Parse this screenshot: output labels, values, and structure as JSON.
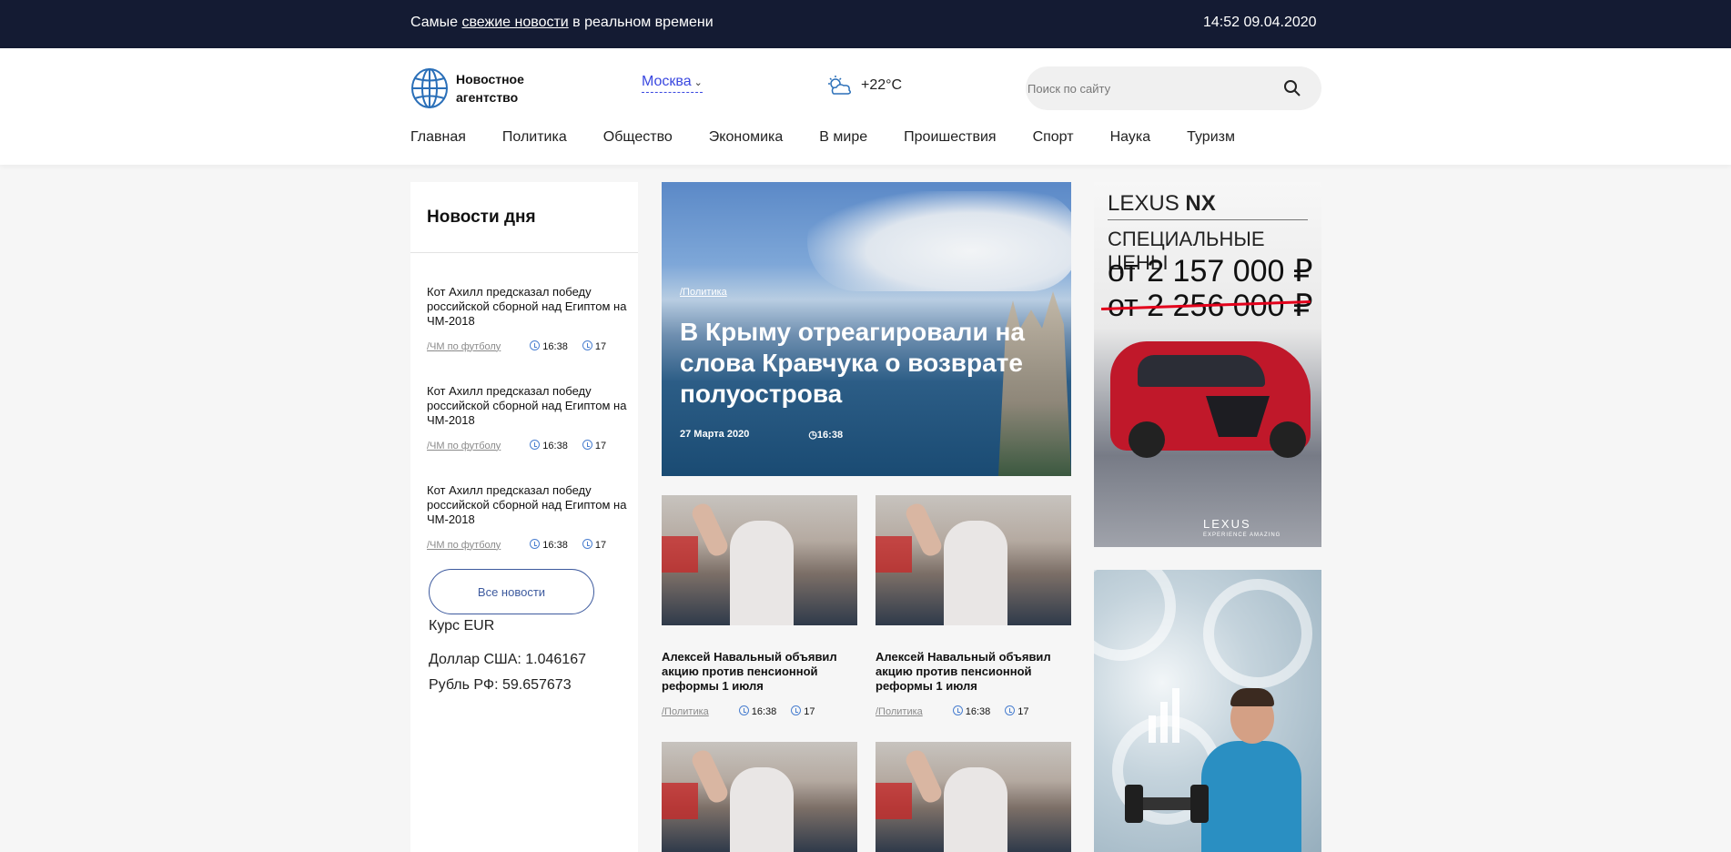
{
  "topbar": {
    "tagline_before": "Самые ",
    "tagline_link": "свежие новости",
    "tagline_after": " в реальном времени",
    "datetime": "14:52 09.04.2020"
  },
  "header": {
    "logo_line1": "Новостное",
    "logo_line2": "агентство",
    "city": "Москва",
    "temperature": "+22°C",
    "search_placeholder": "Поиск по сайту"
  },
  "nav": [
    "Главная",
    "Политика",
    "Общество",
    "Экономика",
    "В мире",
    "Проишествия",
    "Спорт",
    "Наука",
    "Туризм"
  ],
  "sidebar": {
    "title": "Новости дня",
    "items": [
      {
        "title": "Кот Ахилл предсказал победу российской сборной над Египтом на ЧМ-2018",
        "rubric": "/ЧМ по футболу",
        "time": "16:38",
        "comments": "17"
      },
      {
        "title": "Кот Ахилл предсказал победу российской сборной над Египтом на ЧМ-2018",
        "rubric": "/ЧМ по футболу",
        "time": "16:38",
        "comments": "17"
      },
      {
        "title": "Кот Ахилл предсказал победу российской сборной над Египтом на ЧМ-2018",
        "rubric": "/ЧМ по футболу",
        "time": "16:38",
        "comments": "17"
      }
    ],
    "all_news_label": "Все новости",
    "currency_title": "Курс EUR",
    "usd": "Доллар США: 1.046167",
    "rub": "Рубль РФ: 59.657673"
  },
  "hero": {
    "rubric": "/Политика",
    "title": "В Крыму отреагировали на слова Кравчука о возврате полуострова",
    "date": "27 Марта 2020",
    "time": "16:38"
  },
  "cards": [
    {
      "title": "Алексей Навальный объявил акцию против пенсионной реформы 1 июля",
      "rubric": "/Политика",
      "time": "16:38",
      "comments": "17"
    },
    {
      "title": "Алексей Навальный объявил акцию против пенсионной реформы 1 июля",
      "rubric": "/Политика",
      "time": "16:38",
      "comments": "17"
    }
  ],
  "ads": {
    "lexus_brand": "LEXUS",
    "lexus_model": "NX",
    "lexus_special": "СПЕЦИАЛЬНЫЕ ЦЕНЫ",
    "lexus_price_new": "от 2 157 000 ₽",
    "lexus_price_old": "от 2 256 000 ₽",
    "lexus_logo": "LEXUS",
    "lexus_slogan": "EXPERIENCE AMAZING"
  },
  "colors": {
    "topbar_bg": "#141b33",
    "accent_link": "#3a48e0",
    "button_border": "#3d5a9e"
  }
}
